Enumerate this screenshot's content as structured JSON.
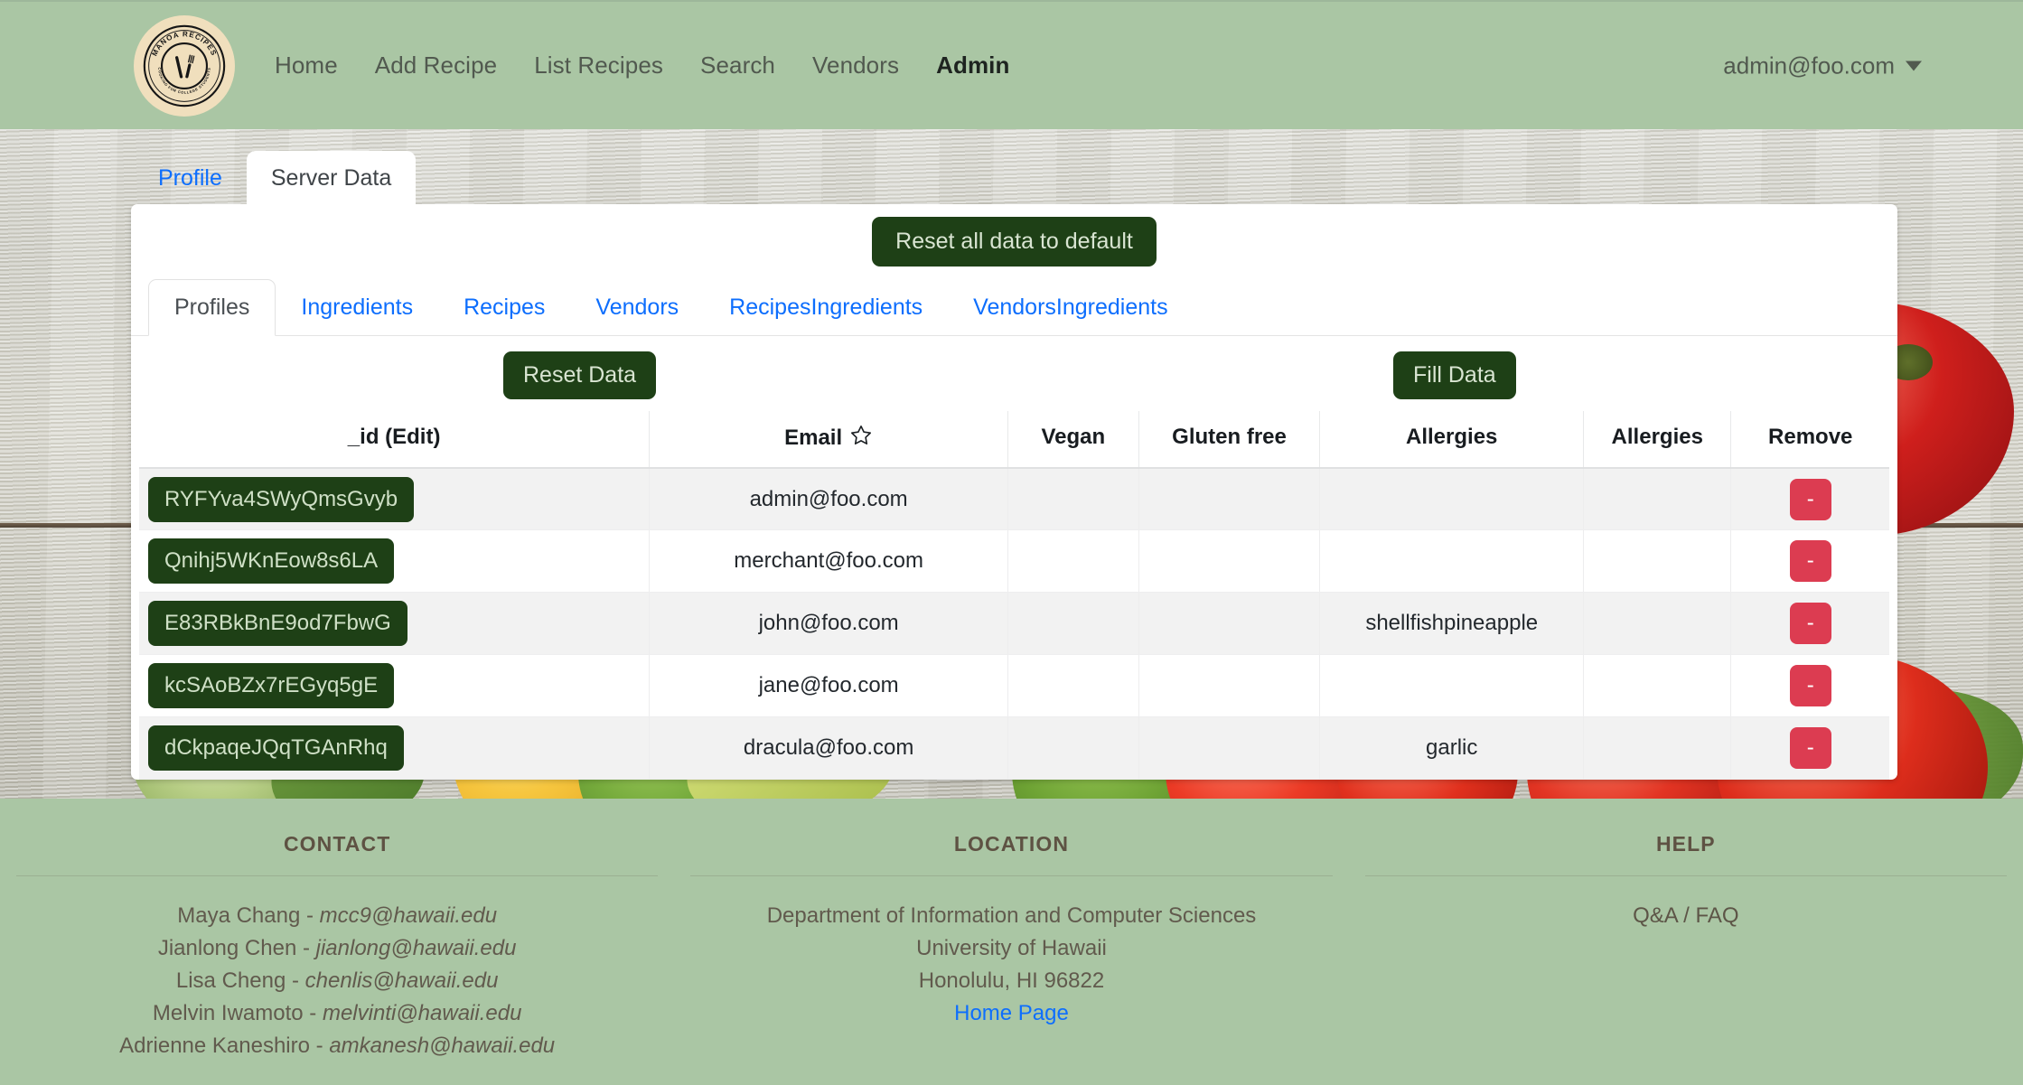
{
  "navbar": {
    "logo": {
      "icon": "manoa-recipes-logo",
      "ring_text_top": "MANOA RECIPES",
      "ring_text_bottom": "COOKING FOR COLLEGE STUDENTS"
    },
    "links": [
      {
        "label": "Home",
        "active": false
      },
      {
        "label": "Add Recipe",
        "active": false
      },
      {
        "label": "List Recipes",
        "active": false
      },
      {
        "label": "Search",
        "active": false
      },
      {
        "label": "Vendors",
        "active": false
      },
      {
        "label": "Admin",
        "active": true
      }
    ],
    "account": {
      "email": "admin@foo.com",
      "caret_icon": "caret-down-icon"
    },
    "bg_color": "#aac6a4"
  },
  "outer_tabs": [
    {
      "label": "Profile",
      "active": false
    },
    {
      "label": "Server Data",
      "active": true
    }
  ],
  "card": {
    "reset_all_label": "Reset all data to default",
    "inner_tabs": [
      {
        "label": "Profiles",
        "active": true
      },
      {
        "label": "Ingredients",
        "active": false
      },
      {
        "label": "Recipes",
        "active": false
      },
      {
        "label": "Vendors",
        "active": false
      },
      {
        "label": "RecipesIngredients",
        "active": false
      },
      {
        "label": "VendorsIngredients",
        "active": false
      }
    ],
    "reset_data_label": "Reset Data",
    "fill_data_label": "Fill Data"
  },
  "table": {
    "headers": [
      "_id (Edit)",
      "Email",
      "Vegan",
      "Gluten free",
      "Allergies",
      "Allergies",
      "Remove"
    ],
    "email_sort_icon": "star-outline-icon",
    "remove_button_label": "-",
    "rows": [
      {
        "id": "RYFYva4SWyQmsGvyb",
        "email": "admin@foo.com",
        "vegan": "",
        "gluten_free": "",
        "allergies1": "",
        "allergies2": ""
      },
      {
        "id": "Qnihj5WKnEow8s6LA",
        "email": "merchant@foo.com",
        "vegan": "",
        "gluten_free": "",
        "allergies1": "",
        "allergies2": ""
      },
      {
        "id": "E83RBkBnE9od7FbwG",
        "email": "john@foo.com",
        "vegan": "",
        "gluten_free": "",
        "allergies1": "shellfishpineapple",
        "allergies2": ""
      },
      {
        "id": "kcSAoBZx7rEGyq5gE",
        "email": "jane@foo.com",
        "vegan": "",
        "gluten_free": "",
        "allergies1": "",
        "allergies2": ""
      },
      {
        "id": "dCkpaqeJQqTGAnRhq",
        "email": "dracula@foo.com",
        "vegan": "",
        "gluten_free": "",
        "allergies1": "garlic",
        "allergies2": ""
      }
    ]
  },
  "footer": {
    "contact": {
      "title": "CONTACT",
      "people": [
        {
          "name": "Maya Chang - ",
          "email": "mcc9@hawaii.edu"
        },
        {
          "name": "Jianlong Chen - ",
          "email": "jianlong@hawaii.edu"
        },
        {
          "name": "Lisa Cheng - ",
          "email": "chenlis@hawaii.edu"
        },
        {
          "name": "Melvin Iwamoto - ",
          "email": "melvinti@hawaii.edu"
        },
        {
          "name": "Adrienne Kaneshiro - ",
          "email": "amkanesh@hawaii.edu"
        }
      ]
    },
    "location": {
      "title": "LOCATION",
      "lines": [
        "Department of Information and Computer Sciences",
        "University of Hawaii",
        "Honolulu, HI 96822"
      ],
      "link": "Home Page"
    },
    "help": {
      "title": "HELP",
      "lines": [
        "Q&A / FAQ"
      ]
    }
  },
  "colors": {
    "nav_bg": "#aac6a4",
    "dark_green_button": "#1e4016",
    "remove_red": "#dc3c51",
    "link_blue": "#0d6efd"
  }
}
